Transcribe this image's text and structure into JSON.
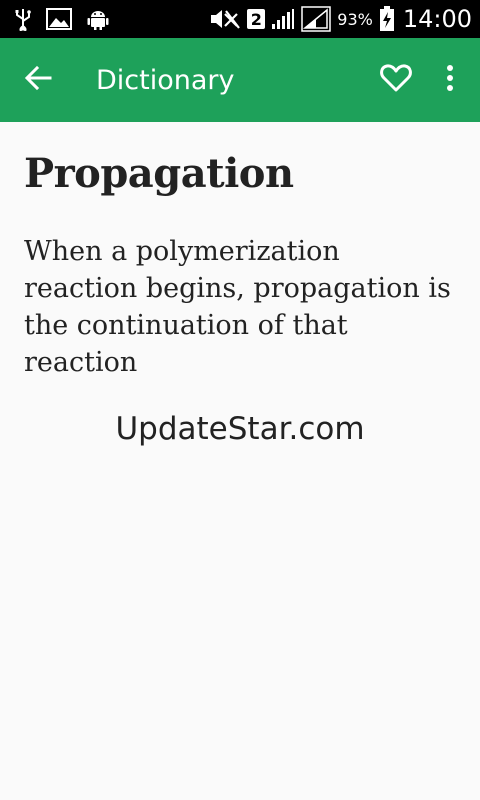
{
  "status_bar": {
    "icons_left": [
      "usb-icon",
      "image-icon",
      "android-debug-icon"
    ],
    "icons_right": [
      "mute-icon",
      "sim-icon",
      "signal-icon",
      "signal-icon"
    ],
    "sim_number": "2",
    "battery_percent": "93%",
    "time": "14:00"
  },
  "app_bar": {
    "title": "Dictionary",
    "color": "#1ea15a"
  },
  "entry": {
    "word": "Propagation",
    "definition": "When a polymerization reaction begins, propagation is the continuation of that reaction"
  },
  "watermark": "UpdateStar.com"
}
